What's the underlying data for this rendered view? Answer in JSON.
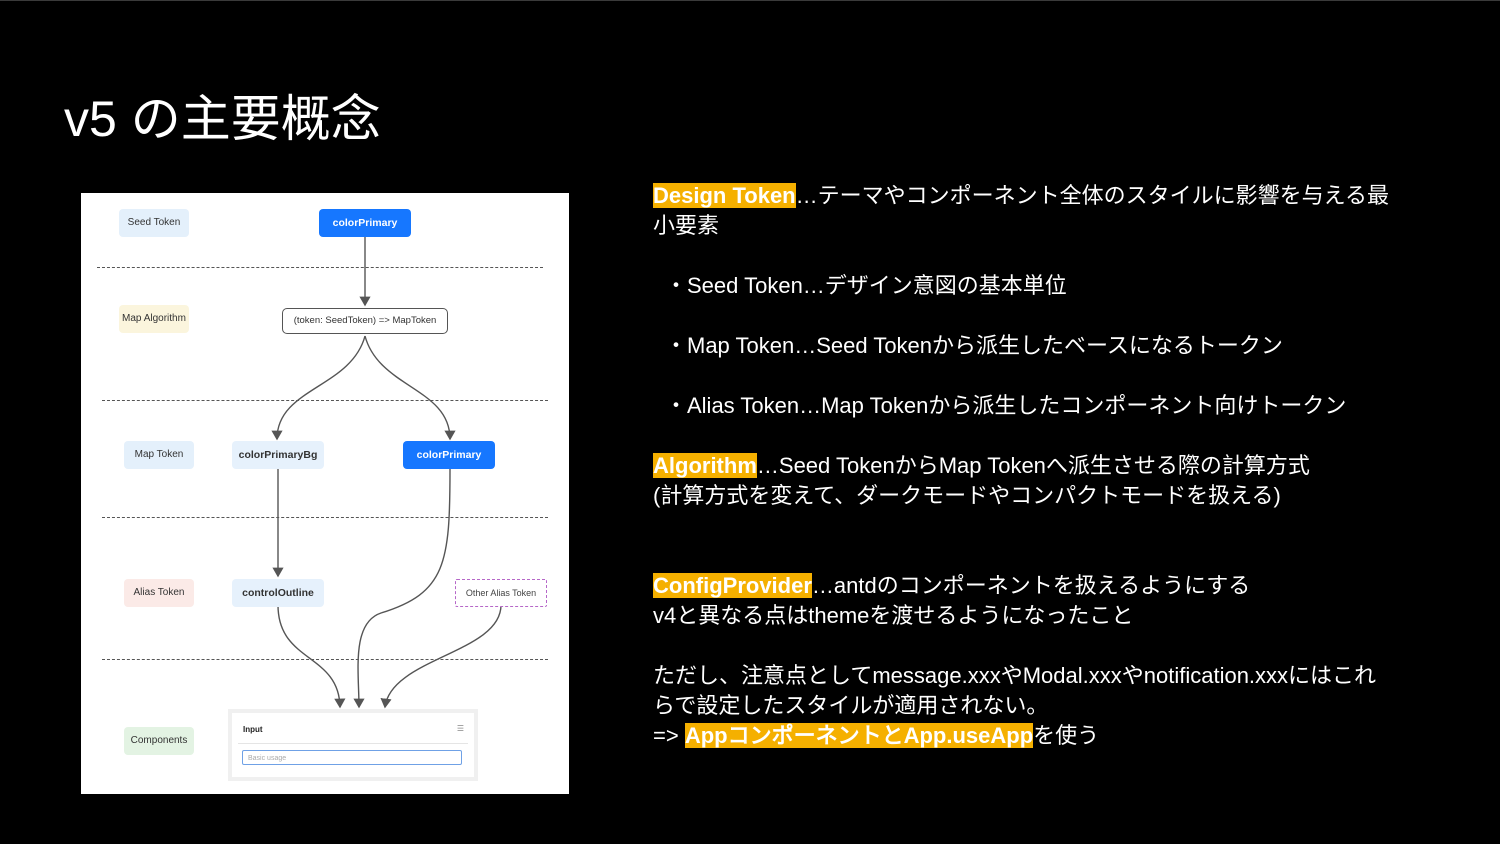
{
  "slide": {
    "title": "v5 の主要概念"
  },
  "diagram": {
    "rows": {
      "seed": "Seed Token",
      "map_algorithm": "Map Algorithm",
      "map_token": "Map Token",
      "alias": "Alias Token",
      "components": "Components"
    },
    "nodes": {
      "color_primary_seed": "colorPrimary",
      "map_function": "(token: SeedToken) => MapToken",
      "color_primary_bg": "colorPrimaryBg",
      "color_primary_map": "colorPrimary",
      "control_outline": "controlOutline",
      "other_alias": "Other Alias Token"
    },
    "input_card": {
      "label": "Input",
      "placeholder": "Basic usage"
    },
    "colors": {
      "node_blue": "#1677ff",
      "node_light": "#e6f1fc"
    }
  },
  "text": {
    "design_token_term": "Design Token",
    "design_token_desc1": "…テーマやコンポーネント全体のスタイルに影響を与える最",
    "design_token_desc2": "小要素",
    "bullet_seed": "・Seed Token…デザイン意図の基本単位",
    "bullet_map": "・Map Token…Seed Tokenから派生したベースになるトークン",
    "bullet_alias": "・Alias Token…Map Tokenから派生したコンポーネント向けトークン",
    "algorithm_term": "Algorithm",
    "algorithm_desc": "…Seed TokenからMap Tokenへ派生させる際の計算方式",
    "algorithm_note": "(計算方式を変えて、ダークモードやコンパクトモードを扱える)",
    "config_term": "ConfigProvider",
    "config_desc": "…antdのコンポーネントを扱えるようにする",
    "config_note": "v4と異なる点はthemeを渡せるようになったこと",
    "caution1": "ただし、注意点としてmessage.xxxやModal.xxxやnotification.xxxにはこれ",
    "caution2": "らで設定したスタイルが適用されない。",
    "arrow_prefix": "=> ",
    "app_component": "Appコンポーネント",
    "and": "と",
    "use_app": "App.useApp",
    "use_suffix": "を使う"
  },
  "accent_color": "#f5b000"
}
